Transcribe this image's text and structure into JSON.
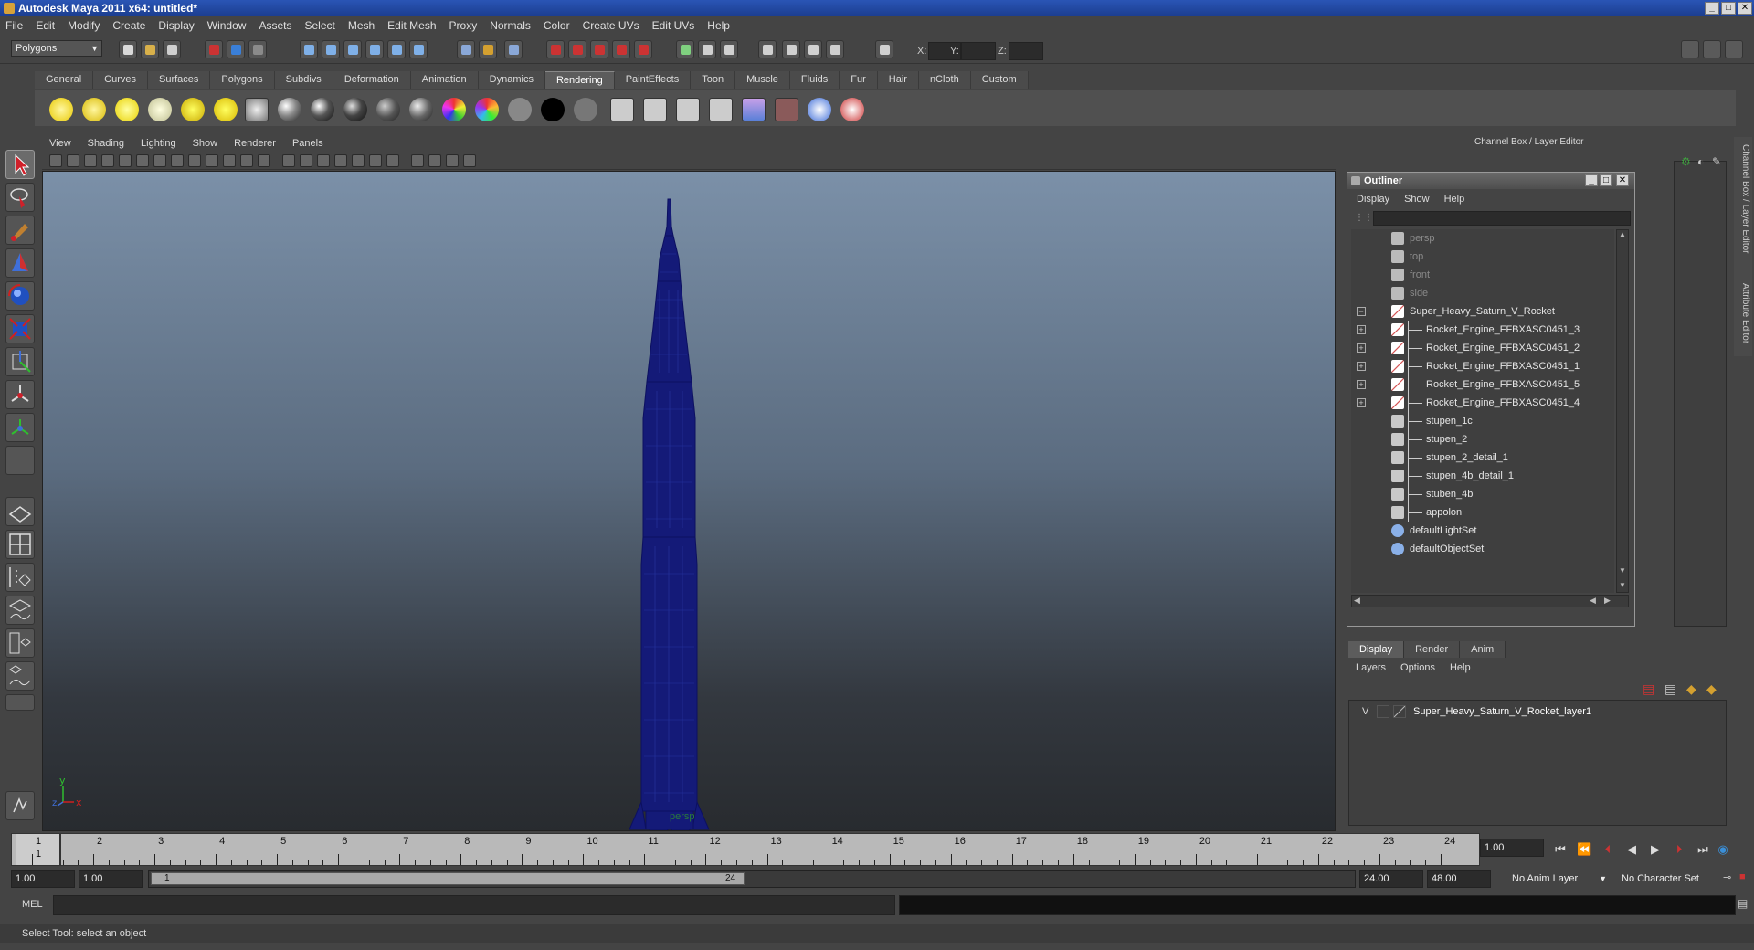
{
  "window": {
    "title": "Autodesk Maya 2011 x64: untitled*",
    "min_glyph": "_",
    "max_glyph": "□",
    "close_glyph": "✕"
  },
  "menubar": [
    "File",
    "Edit",
    "Modify",
    "Create",
    "Display",
    "Window",
    "Assets",
    "Select",
    "Mesh",
    "Edit Mesh",
    "Proxy",
    "Normals",
    "Color",
    "Create UVs",
    "Edit UVs",
    "Help"
  ],
  "statusline": {
    "mode": "Polygons",
    "x_label": "X:",
    "y_label": "Y:",
    "z_label": "Z:"
  },
  "shelf": {
    "tabs": [
      "General",
      "Curves",
      "Surfaces",
      "Polygons",
      "Subdivs",
      "Deformation",
      "Animation",
      "Dynamics",
      "Rendering",
      "PaintEffects",
      "Toon",
      "Muscle",
      "Fluids",
      "Fur",
      "Hair",
      "nCloth",
      "Custom"
    ],
    "active_tab": "Rendering"
  },
  "viewport": {
    "menu": [
      "View",
      "Shading",
      "Lighting",
      "Show",
      "Renderer",
      "Panels"
    ],
    "camera": "persp",
    "axis_y": "y",
    "axis_x": "x",
    "axis_z": "z",
    "mesh_color": "#141a78"
  },
  "channelbox": {
    "title": "Channel Box / Layer Editor",
    "side_tab_1": "Channel Box / Layer Editor",
    "side_tab_2": "Attribute Editor"
  },
  "outliner": {
    "title": "Outliner",
    "menu": [
      "Display",
      "Show",
      "Help"
    ],
    "items": [
      {
        "label": "persp",
        "icon": "camera-icon",
        "level": 0,
        "dim": true,
        "expand": ""
      },
      {
        "label": "top",
        "icon": "camera-icon",
        "level": 0,
        "dim": true,
        "expand": ""
      },
      {
        "label": "front",
        "icon": "camera-icon",
        "level": 0,
        "dim": true,
        "expand": ""
      },
      {
        "label": "side",
        "icon": "camera-icon",
        "level": 0,
        "dim": true,
        "expand": ""
      },
      {
        "label": "Super_Heavy_Saturn_V_Rocket",
        "icon": "transform-icon",
        "level": 0,
        "dim": false,
        "expand": "−"
      },
      {
        "label": "Rocket_Engine_FFBXASC0451_3",
        "icon": "transform-icon",
        "level": 1,
        "dim": false,
        "expand": "+"
      },
      {
        "label": "Rocket_Engine_FFBXASC0451_2",
        "icon": "transform-icon",
        "level": 1,
        "dim": false,
        "expand": "+"
      },
      {
        "label": "Rocket_Engine_FFBXASC0451_1",
        "icon": "transform-icon",
        "level": 1,
        "dim": false,
        "expand": "+"
      },
      {
        "label": "Rocket_Engine_FFBXASC0451_5",
        "icon": "transform-icon",
        "level": 1,
        "dim": false,
        "expand": "+"
      },
      {
        "label": "Rocket_Engine_FFBXASC0451_4",
        "icon": "transform-icon",
        "level": 1,
        "dim": false,
        "expand": "+"
      },
      {
        "label": "stupen_1c",
        "icon": "mesh-icon",
        "level": 1,
        "dim": false,
        "expand": ""
      },
      {
        "label": "stupen_2",
        "icon": "mesh-icon",
        "level": 1,
        "dim": false,
        "expand": ""
      },
      {
        "label": "stupen_2_detail_1",
        "icon": "mesh-icon",
        "level": 1,
        "dim": false,
        "expand": ""
      },
      {
        "label": "stupen_4b_detail_1",
        "icon": "mesh-icon",
        "level": 1,
        "dim": false,
        "expand": ""
      },
      {
        "label": "stuben_4b",
        "icon": "mesh-icon",
        "level": 1,
        "dim": false,
        "expand": ""
      },
      {
        "label": "appolon",
        "icon": "mesh-icon",
        "level": 1,
        "dim": false,
        "expand": ""
      },
      {
        "label": "defaultLightSet",
        "icon": "set-icon",
        "level": 0,
        "dim": false,
        "expand": ""
      },
      {
        "label": "defaultObjectSet",
        "icon": "set-icon",
        "level": 0,
        "dim": false,
        "expand": ""
      }
    ]
  },
  "layers": {
    "tabs": [
      "Display",
      "Render",
      "Anim"
    ],
    "active_tab": "Display",
    "menu": [
      "Layers",
      "Options",
      "Help"
    ],
    "rows": [
      {
        "visible": "V",
        "name": "Super_Heavy_Saturn_V_Rocket_layer1"
      }
    ]
  },
  "timeslider": {
    "frames": [
      "1",
      "2",
      "3",
      "4",
      "5",
      "6",
      "7",
      "8",
      "9",
      "10",
      "11",
      "12",
      "13",
      "14",
      "15",
      "16",
      "17",
      "18",
      "19",
      "20",
      "21",
      "22",
      "23",
      "24"
    ],
    "current_frame": "1",
    "current_time_field": "1.00"
  },
  "range": {
    "start_time": "1.00",
    "playback_start": "1.00",
    "thumb_start": "1",
    "thumb_end": "24",
    "playback_end": "24.00",
    "end_time": "48.00",
    "anim_layer": "No Anim Layer",
    "character_set": "No Character Set"
  },
  "commandline": {
    "label": "MEL"
  },
  "helpline": {
    "text": "Select Tool: select an object"
  }
}
